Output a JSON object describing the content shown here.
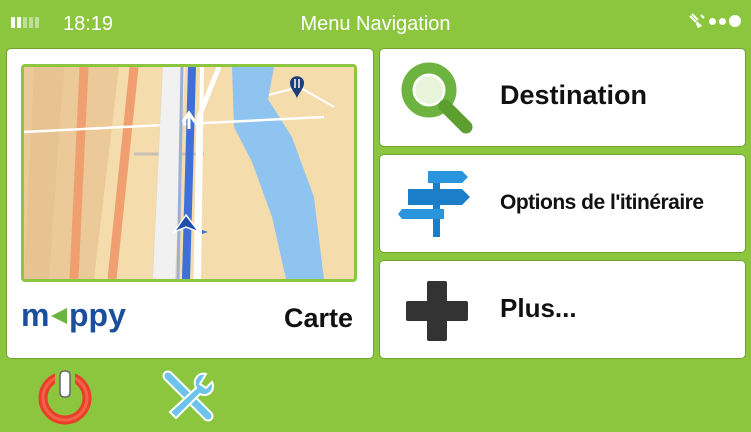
{
  "status_bar": {
    "time": "18:19",
    "title": "Menu Navigation",
    "signal_icon": "signal-bars-icon",
    "gps_icon": "gps-satellite-icon"
  },
  "map_tile": {
    "brand": {
      "before": "m",
      "after": "ppy",
      "accent_color": "#6db33f",
      "text_color": "#1a4f9c"
    },
    "label": "Carte",
    "poi_icon": "restaurant-pin-icon",
    "position_icon": "vehicle-arrow-icon"
  },
  "menu": {
    "destination": {
      "label": "Destination",
      "icon": "search-magnifier-icon"
    },
    "route_options": {
      "label": "Options de l'itinéraire",
      "icon": "signpost-icon"
    },
    "more": {
      "label": "Plus...",
      "icon": "plus-icon"
    }
  },
  "bottom_bar": {
    "power_icon": "power-icon",
    "settings_icon": "tools-icon"
  },
  "colors": {
    "background": "#8cc63f",
    "panel": "#ffffff",
    "accent_green": "#6db33f",
    "route_blue": "#3f6fd8",
    "river_blue": "#8fc3f0",
    "power_red": "#e8402a",
    "tools_blue": "#6cc3ec"
  }
}
